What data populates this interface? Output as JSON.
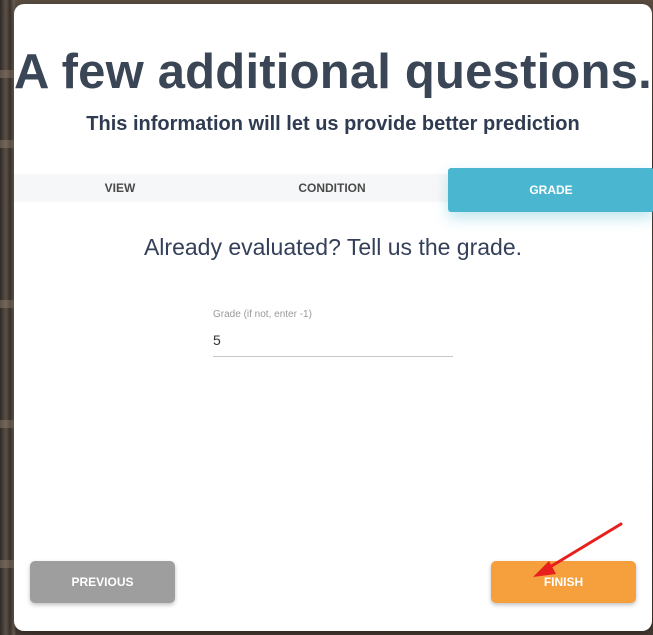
{
  "dialog": {
    "title": "A few additional questions.",
    "subtitle": "This information will let us provide better prediction"
  },
  "tabs": [
    {
      "label": "VIEW",
      "active": false
    },
    {
      "label": "CONDITION",
      "active": false
    },
    {
      "label": "GRADE",
      "active": true
    }
  ],
  "step": {
    "prompt": "Already evaluated? Tell us the grade.",
    "field": {
      "label": "Grade (if not, enter -1)",
      "value": "5"
    }
  },
  "buttons": {
    "previous": "PREVIOUS",
    "finish": "FINISH"
  },
  "colors": {
    "active_tab": "#4ab6d0",
    "finish_button": "#f5a03c",
    "previous_button": "#9e9e9e",
    "heading": "#3a4556",
    "annotation_arrow": "#e8201c"
  },
  "icons": {
    "annotation": "red-arrow-icon"
  }
}
